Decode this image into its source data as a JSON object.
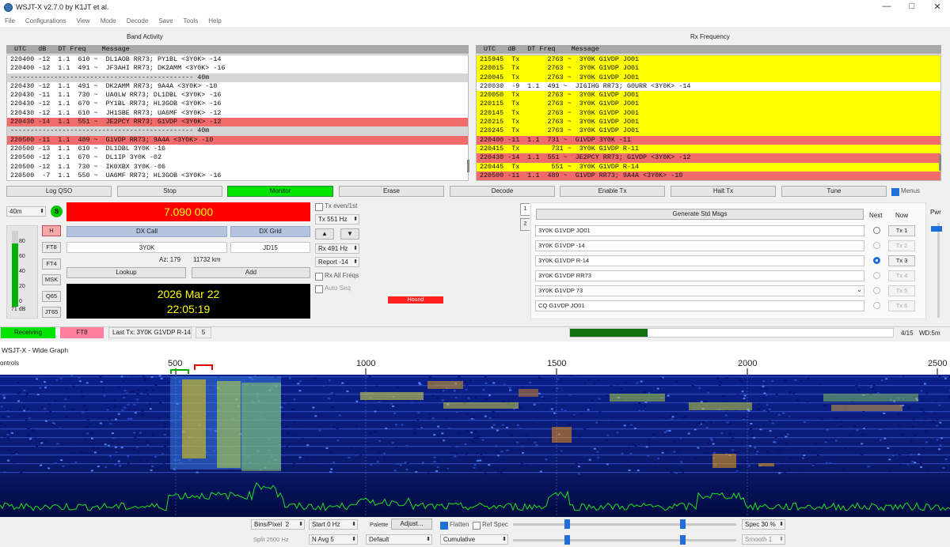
{
  "window": {
    "title": "WSJT-X   v2.7.0   by K1JT et al."
  },
  "menu": [
    "File",
    "Configurations",
    "View",
    "Mode",
    "Decode",
    "Save",
    "Tools",
    "Help"
  ],
  "band_activity": {
    "title": "Band Activity",
    "header": "  UTC   dB   DT Freq    Message",
    "rows": [
      {
        "text": "220400 -12  1.1  610 ~  DL1AOB RR73; PY1BL <3Y0K> -14",
        "style": "normal"
      },
      {
        "text": "220400 -12  1.1  491 ~  JF3AHI RR73; DK2AMM <3Y0K> -16",
        "style": "normal"
      },
      {
        "text": "---------------------------------------------- 40m",
        "style": "sep"
      },
      {
        "text": "220430 -12  1.1  491 ~  DK2AMM RR73; 9A4A <3Y0K> -10",
        "style": "normal"
      },
      {
        "text": "220430 -11  1.1  730 ~  UA0LW RR73; DL1DBL <3Y0K> -16",
        "style": "normal"
      },
      {
        "text": "220430 -12  1.1  670 ~  PY1BL RR73; HL3GOB <3Y0K> -16",
        "style": "normal"
      },
      {
        "text": "220430 -12  1.1  610 ~  JH1SBE RR73; UA6MF <3Y0K> -12",
        "style": "normal"
      },
      {
        "text": "220430 -14  1.1  551 ~  JE2PCY RR73; G1VDP <3Y0K> -12",
        "style": "red"
      },
      {
        "text": "---------------------------------------------- 40m",
        "style": "sep"
      },
      {
        "text": "220500 -11  1.1  489 ~  G1VDP RR73; 9A4A <3Y0K> -10",
        "style": "red"
      },
      {
        "text": "220500 -13  1.1  610 ~  DL1DBL 3Y0K -16",
        "style": "normal"
      },
      {
        "text": "220500 -12  1.1  670 ~  DL1IP 3Y0K -02",
        "style": "normal"
      },
      {
        "text": "220500 -12  1.1  730 ~  IK0XBX 3Y0K -06",
        "style": "normal"
      },
      {
        "text": "220500  -7  1.1  550 ~  UA6MF RR73; HL3GOB <3Y0K> -16",
        "style": "normal"
      }
    ]
  },
  "rx_frequency": {
    "title": "Rx Frequency",
    "header": "  UTC   dB   DT Freq    Message",
    "rows": [
      {
        "text": "215945  Tx       2763 ~  3Y0K G1VDP JO01",
        "style": "yel"
      },
      {
        "text": "220015  Tx       2763 ~  3Y0K G1VDP JO01",
        "style": "yel"
      },
      {
        "text": "220045  Tx       2763 ~  3Y0K G1VDP JO01",
        "style": "yel"
      },
      {
        "text": "220030  -9  1.1  491 ~  JI6IHG RR73; G0URR <3Y0K> -14",
        "style": "normal"
      },
      {
        "text": "220050  Tx       2763 ~  3Y0K G1VDP JO01",
        "style": "yel"
      },
      {
        "text": "220115  Tx       2763 ~  3Y0K G1VDP JO01",
        "style": "yel"
      },
      {
        "text": "220145  Tx       2763 ~  3Y0K G1VDP JO01",
        "style": "yel"
      },
      {
        "text": "220215  Tx       2763 ~  3Y0K G1VDP JO01",
        "style": "yel"
      },
      {
        "text": "220245  Tx       2763 ~  3Y0K G1VDP JO01",
        "style": "yel"
      },
      {
        "text": "220400 -11  1.1  731 ~  G1VDP 3Y0K -11",
        "style": "red"
      },
      {
        "text": "220415  Tx        731 ~  3Y0K G1VDP R-11",
        "style": "yel"
      },
      {
        "text": "220430 -14  1.1  551 ~  JE2PCY RR73; G1VDP <3Y0K> -12",
        "style": "red"
      },
      {
        "text": "220445  Tx        551 ~  3Y0K G1VDP R-14",
        "style": "yel"
      },
      {
        "text": "220500 -11  1.1  489 ~  G1VDP RR73; 9A4A <3Y0K> -10",
        "style": "red"
      }
    ]
  },
  "buttons": {
    "log_qso": "Log QSO",
    "stop": "Stop",
    "monitor": "Monitor",
    "erase": "Erase",
    "decode": "Decode",
    "enable_tx": "Enable Tx",
    "halt_tx": "Halt Tx",
    "tune": "Tune",
    "menus": "Menus"
  },
  "left": {
    "band": "40m",
    "s_label": "S",
    "frequency": "7.090 000",
    "dx_call_label": "DX Call",
    "dx_grid_label": "DX Grid",
    "dx_call": "3Y0K",
    "dx_grid": "JD15",
    "az": "Az: 179",
    "distance": "11732 km",
    "lookup": "Lookup",
    "add": "Add",
    "date": "2026 Mar 22",
    "time": "22:05:19",
    "meter_ticks": [
      "80",
      "60",
      "40",
      "20",
      "0"
    ],
    "meter_db": "71 dB",
    "modes": [
      "H",
      "FT8",
      "FT4",
      "MSK",
      "Q65",
      "JT65"
    ]
  },
  "middle": {
    "tx_even": "Tx even/1st",
    "tx_freq": "Tx  551  Hz",
    "rx_freq": "Rx  491  Hz",
    "report": "Report -14",
    "rx_all": "Rx All Freqs",
    "auto_seq": "Auto Seq",
    "hound": "Hound",
    "tab1": "1",
    "tab2": "2"
  },
  "right": {
    "generate": "Generate Std Msgs",
    "next_label": "Next",
    "now_label": "Now",
    "pwr_label": "Pwr",
    "messages": [
      "3Y0K G1VDP JO01",
      "3Y0K G1VDP -14",
      "3Y0K G1VDP R-14",
      "3Y0K G1VDP RR73",
      "3Y0K G1VDP 73",
      "CQ G1VDP JO01"
    ],
    "tx_buttons": [
      "Tx 1",
      "Tx 2",
      "Tx 3",
      "Tx 4",
      "Tx 5",
      "Tx 6"
    ]
  },
  "status": {
    "receiving": "Receiving",
    "mode": "FT8",
    "last_tx": "Last Tx: 3Y0K G1VDP R-14",
    "count": "5",
    "progress": 0.24,
    "periods": "4/15",
    "wd": "WD:5m"
  },
  "widegraph": {
    "title": "WSJT-X - Wide Graph",
    "controls": "ontrols",
    "scale": [
      "500",
      "1000",
      "1500",
      "2000",
      "2500"
    ]
  },
  "bottom": {
    "bins_label": "Bins/Pixel",
    "bins": "2",
    "start": "Start 0 Hz",
    "palette": "Palette",
    "adjust": "Adjust...",
    "flatten": "Flatten",
    "ref_spec": "Ref Spec",
    "spec": "Spec 30 %",
    "split": "Split  2500  Hz",
    "navg": "N Avg 5",
    "default": "Default",
    "cumulative": "Cumulative",
    "smooth": "Smooth  1"
  },
  "colors": {
    "red": "#f26b6b",
    "yellow": "#ffff00",
    "monitor": "#00e400",
    "freq_bg": "#ff0000",
    "freq_fg": "#ffff00",
    "clock_bg": "#000000",
    "clock_fg": "#ffff00",
    "receiving": "#00e400",
    "ft8": "#ff7f9f",
    "progress": "#107010"
  }
}
